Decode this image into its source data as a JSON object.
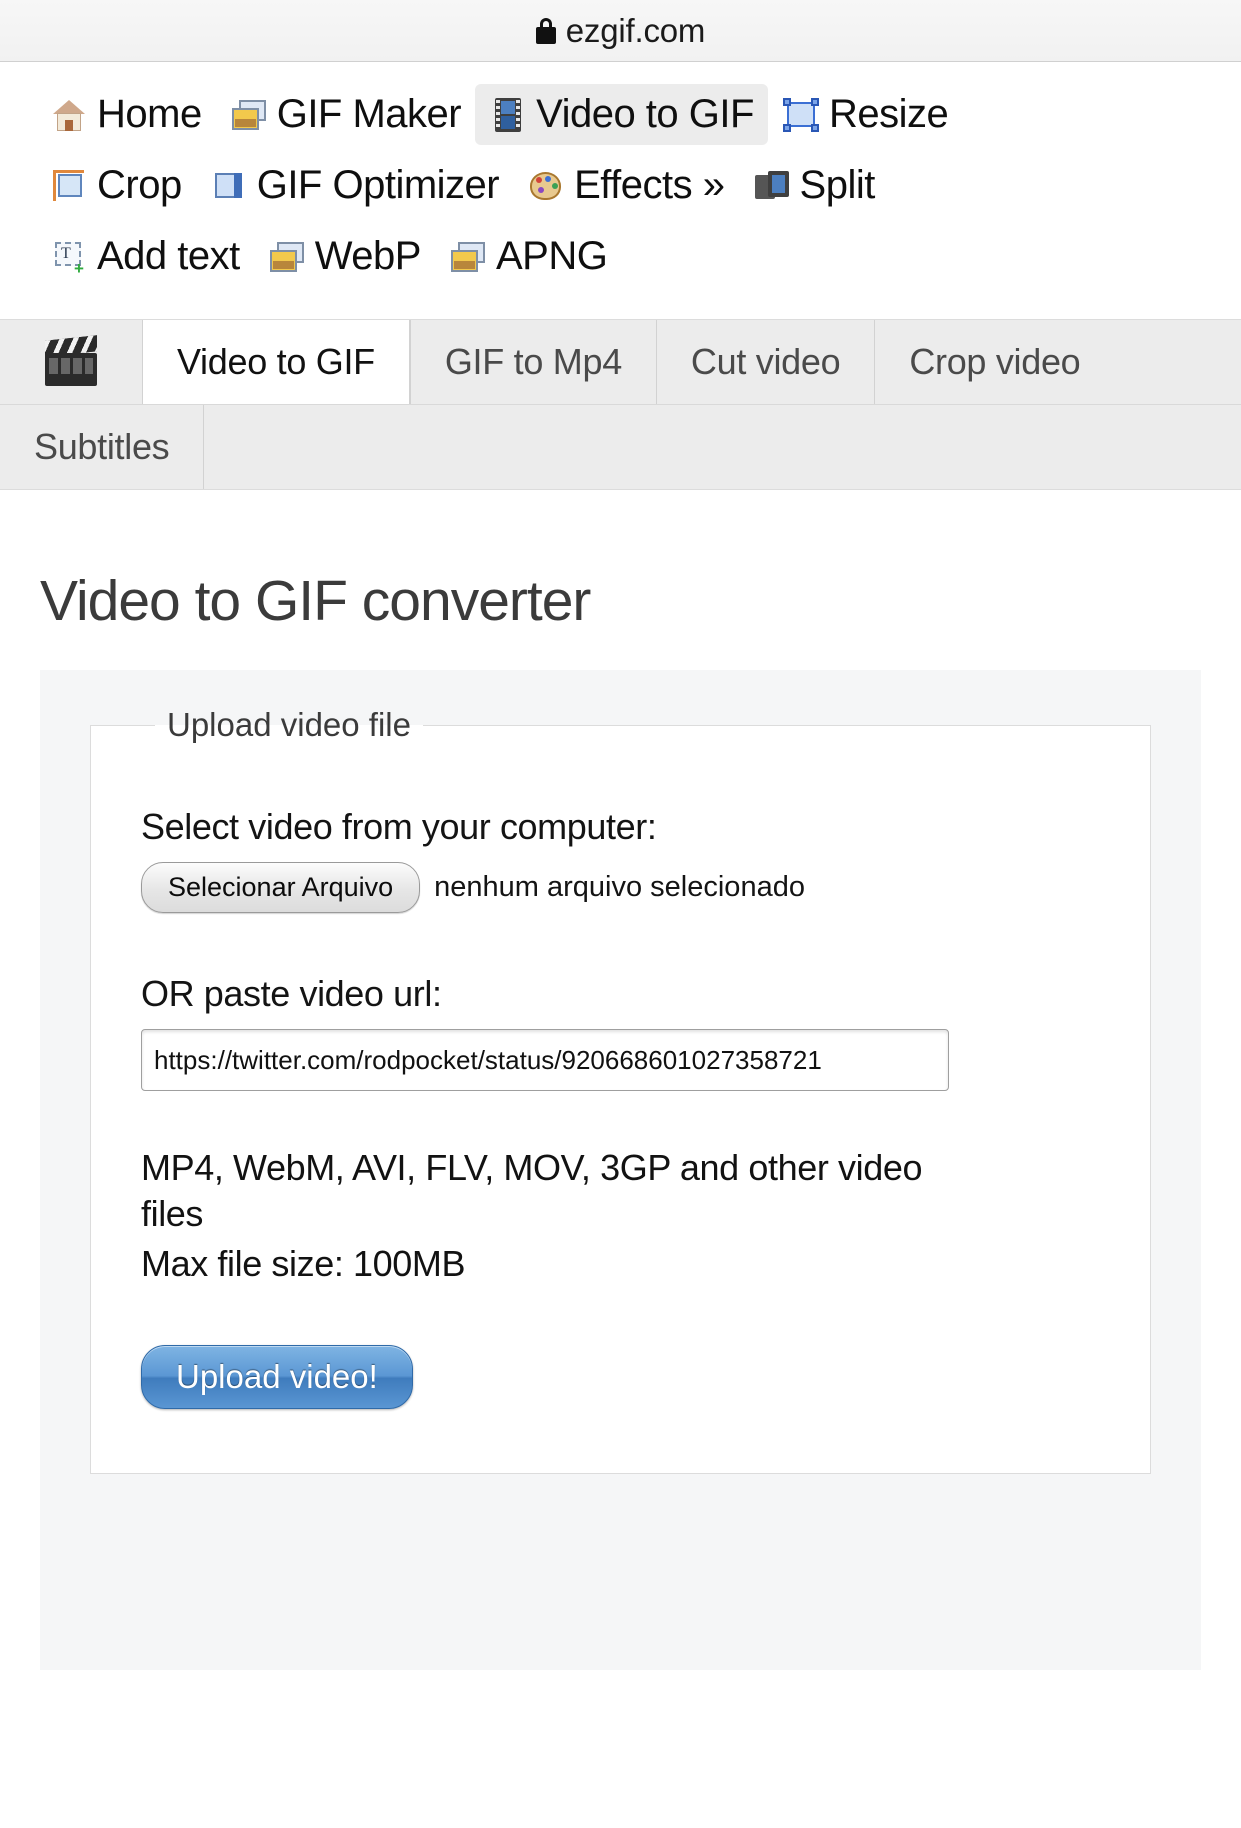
{
  "browser": {
    "lock_icon": "lock-icon",
    "url": "ezgif.com"
  },
  "topnav": {
    "rows": [
      [
        {
          "icon": "home-icon",
          "label": "Home",
          "active": false
        },
        {
          "icon": "gif-maker-icon",
          "label": "GIF Maker",
          "active": false
        },
        {
          "icon": "video-to-gif-icon",
          "label": "Video to GIF",
          "active": true
        },
        {
          "icon": "resize-icon",
          "label": "Resize",
          "active": false
        }
      ],
      [
        {
          "icon": "crop-icon",
          "label": "Crop",
          "active": false
        },
        {
          "icon": "gif-optimizer-icon",
          "label": "GIF Optimizer",
          "active": false
        },
        {
          "icon": "effects-icon",
          "label": "Effects »",
          "active": false
        },
        {
          "icon": "split-icon",
          "label": "Split",
          "active": false
        }
      ],
      [
        {
          "icon": "add-text-icon",
          "label": "Add text",
          "active": false
        },
        {
          "icon": "webp-icon",
          "label": "WebP",
          "active": false
        },
        {
          "icon": "apng-icon",
          "label": "APNG",
          "active": false
        }
      ]
    ]
  },
  "subtabs": {
    "icon": "clapperboard-icon",
    "row1": [
      {
        "label": "Video to GIF",
        "active": true
      },
      {
        "label": "GIF to Mp4",
        "active": false
      },
      {
        "label": "Cut video",
        "active": false
      },
      {
        "label": "Crop video",
        "active": false
      }
    ],
    "row2": [
      {
        "label": "Subtitles",
        "active": false
      }
    ]
  },
  "main": {
    "title": "Video to GIF converter",
    "upload": {
      "legend": "Upload video file",
      "file_label": "Select video from your computer:",
      "file_button": "Selecionar Arquivo",
      "file_status": "nenhum arquivo selecionado",
      "url_label": "OR paste video url:",
      "url_value": "https://twitter.com/rodpocket/status/920668601027358721",
      "url_placeholder": "",
      "formats_hint": "MP4, WebM, AVI, FLV, MOV, 3GP and other video files",
      "max_size_hint": "Max file size: 100MB",
      "submit_label": "Upload video!"
    }
  },
  "colors": {
    "accent_blue": "#5b97d4",
    "panel_bg": "#f5f6f7",
    "tabbar_bg": "#ececec",
    "active_nav_bg": "#ececec"
  }
}
